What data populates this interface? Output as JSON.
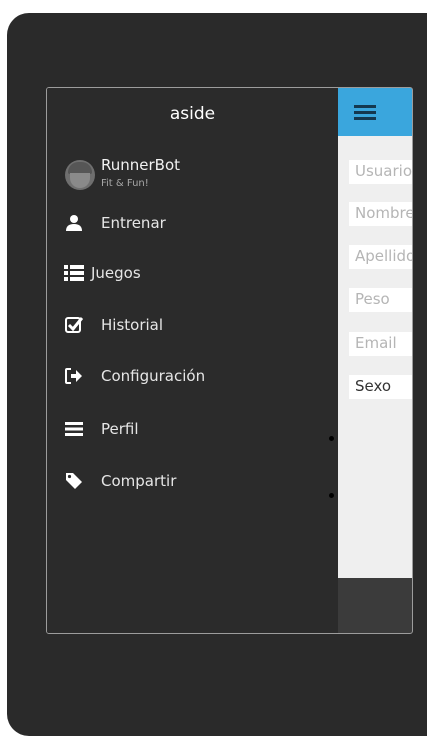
{
  "aside": {
    "title": "aside",
    "profile": {
      "name": "RunnerBot",
      "tagline": "Fit & Fun!",
      "avatar_icon": "robot-avatar-icon"
    },
    "items": [
      {
        "label": "Entrenar",
        "icon": "user-icon"
      },
      {
        "label": "Juegos",
        "icon": "list-icon"
      },
      {
        "label": "Historial",
        "icon": "checkbox-icon"
      },
      {
        "label": "Configuración",
        "icon": "sign-out-icon"
      },
      {
        "label": "Perfil",
        "icon": "bars-icon"
      },
      {
        "label": "Compartir",
        "icon": "tag-icon"
      }
    ]
  },
  "main": {
    "menu_icon": "hamburger-icon",
    "fields": [
      {
        "placeholder": "Usuario"
      },
      {
        "placeholder": "Nombre"
      },
      {
        "placeholder": "Apellido"
      },
      {
        "placeholder": "Peso"
      },
      {
        "placeholder": "Email"
      }
    ],
    "select": {
      "value": "Sexo"
    }
  },
  "colors": {
    "topbar": "#3aa6dd",
    "aside_bg": "#2b2b2b",
    "content_bg": "#efefef",
    "device_bg": "#2a2a2a"
  }
}
